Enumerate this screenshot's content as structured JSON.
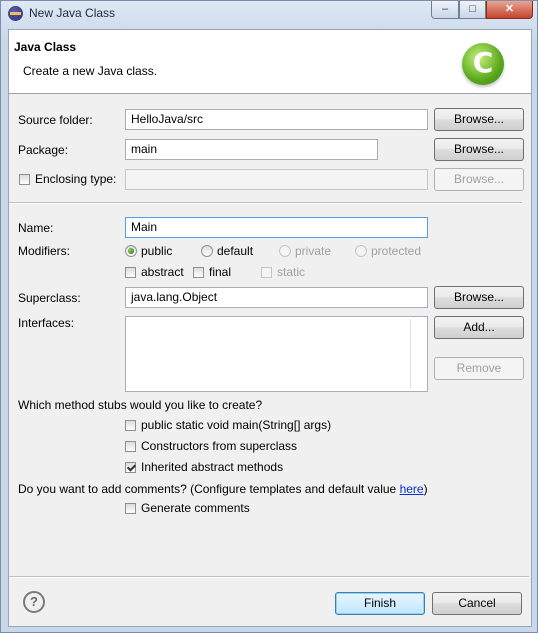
{
  "window": {
    "title": "New Java Class",
    "minimize": "‒",
    "maximize": "□",
    "close": "✕"
  },
  "banner": {
    "title": "Java Class",
    "description": "Create a new Java class.",
    "logo_letter": "C"
  },
  "source_folder": {
    "label": "Source folder:",
    "value": "HelloJava/src",
    "browse": "Browse..."
  },
  "package": {
    "label": "Package:",
    "value": "main",
    "browse": "Browse..."
  },
  "enclosing": {
    "label": "Enclosing type:",
    "value": "",
    "browse": "Browse...",
    "checked": false
  },
  "name": {
    "label": "Name:",
    "value": "Main"
  },
  "modifiers": {
    "label": "Modifiers:",
    "access": [
      {
        "label": "public",
        "selected": true,
        "enabled": true
      },
      {
        "label": "default",
        "selected": false,
        "enabled": true
      },
      {
        "label": "private",
        "selected": false,
        "enabled": false
      },
      {
        "label": "protected",
        "selected": false,
        "enabled": false
      }
    ],
    "abstract": "abstract",
    "final": "final",
    "static": "static"
  },
  "superclass": {
    "label": "Superclass:",
    "value": "java.lang.Object",
    "browse": "Browse..."
  },
  "interfaces": {
    "label": "Interfaces:",
    "add": "Add...",
    "remove": "Remove",
    "items": []
  },
  "stubs": {
    "question": "Which method stubs would you like to create?",
    "main": {
      "label": "public static void main(String[] args)",
      "checked": false
    },
    "constructors": {
      "label": "Constructors from superclass",
      "checked": false
    },
    "inherited": {
      "label": "Inherited abstract methods",
      "checked": true
    }
  },
  "comments": {
    "question": "Do you want to add comments? (Configure templates and default value ",
    "link": "here",
    "question_end": ")",
    "generate": {
      "label": "Generate comments",
      "checked": false
    }
  },
  "footer": {
    "help": "?",
    "finish": "Finish",
    "cancel": "Cancel"
  }
}
